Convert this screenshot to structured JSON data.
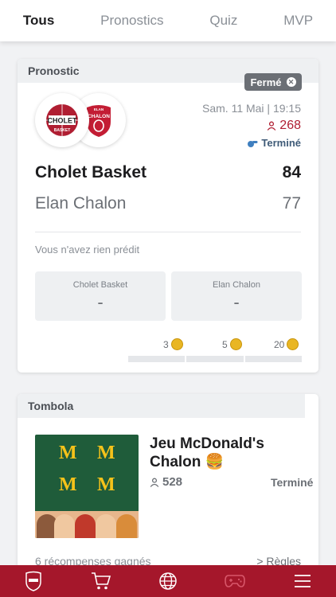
{
  "tabs": [
    {
      "label": "Tous",
      "active": true
    },
    {
      "label": "Pronostics",
      "active": false
    },
    {
      "label": "Quiz",
      "active": false
    },
    {
      "label": "MVP",
      "active": false
    }
  ],
  "prediction_card": {
    "header": "Pronostic",
    "status_chip": "Fermé",
    "date": "Sam. 11 Mai | 19:15",
    "participants": "268",
    "match_status": "Terminé",
    "home": {
      "name": "Cholet Basket",
      "score": "84",
      "logo_text": "CHOLET",
      "logo_sub": "BASKET"
    },
    "away": {
      "name": "Elan Chalon",
      "score": "77",
      "logo_text": "CHALON",
      "logo_sub": "ELAN"
    },
    "no_prediction": "Vous n'avez rien prédit",
    "prediction_boxes": [
      {
        "label": "Cholet Basket",
        "value": "-"
      },
      {
        "label": "Elan Chalon",
        "value": "-"
      }
    ],
    "reward_tiers": [
      "3",
      "5",
      "20"
    ]
  },
  "tombola_card": {
    "header": "Tombola",
    "title": "Jeu McDonald's Chalon 🍔",
    "participants": "528",
    "status": "Terminé",
    "rewards": "6 récompenses gagnés",
    "rules": "> Règles",
    "promo_letter": "M"
  },
  "bottom_nav": [
    "club-logo-icon",
    "cart-icon",
    "globe-icon",
    "gamepad-icon",
    "menu-icon"
  ],
  "colors": {
    "brand": "#a5172b",
    "accent_red": "#b01e32",
    "chip": "#6b6f75",
    "status_blue": "#3f5b78"
  }
}
